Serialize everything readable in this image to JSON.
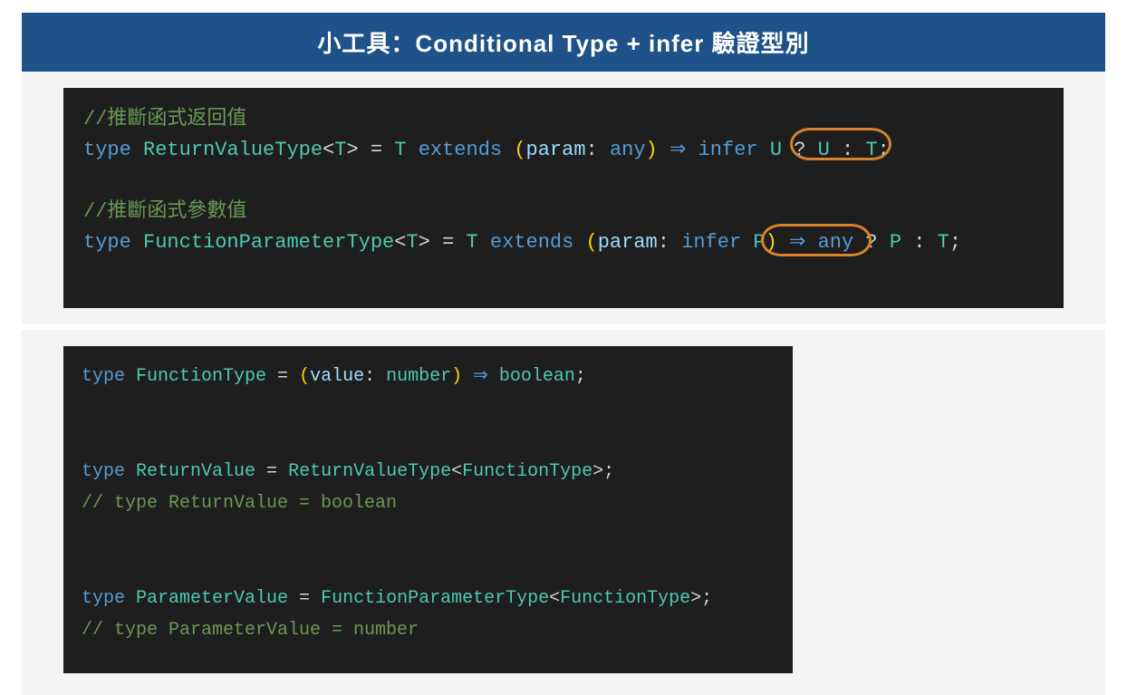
{
  "header": {
    "title": "小工具：Conditional Type + infer  驗證型別"
  },
  "code1": {
    "c1": "//推斷函式返回值",
    "l2": {
      "kw_type": "type ",
      "name": "ReturnValueType",
      "lt": "<",
      "T": "T",
      "gt": ">",
      "eq": " = ",
      "T2": "T ",
      "kw_extends": "extends ",
      "lp": "(",
      "param": "param",
      "colon": ": ",
      "any": "any",
      "rp": ") ",
      "arrow": "⇒ ",
      "infer": "infer ",
      "U": "U ",
      "qmark": "?",
      "sp": " ",
      "U2": "U ",
      "colon2": ": ",
      "T3": "T",
      "semi": ";"
    },
    "blank": "",
    "c2": "//推斷函式參數值",
    "l4": {
      "kw_type": "type ",
      "name": "FunctionParameterType",
      "lt": "<",
      "T": "T",
      "gt": ">",
      "eq": " = ",
      "T2": "T ",
      "kw_extends": "extends ",
      "lp": "(",
      "param": "param",
      "colon": ": ",
      "infer": "infer ",
      "P": "P",
      "rp": ")",
      "sp": " ",
      "arrow": "⇒ ",
      "any": "any ",
      "qmark": "?",
      "sp2": " ",
      "P2": "P ",
      "colon2": ": ",
      "T3": "T",
      "semi": ";"
    }
  },
  "code2": {
    "l1": {
      "kw_type": "type ",
      "name": "FunctionType",
      "eq": " = ",
      "lp": "(",
      "param": "value",
      "colon": ": ",
      "ptype": "number",
      "rp": ") ",
      "arrow": "⇒ ",
      "ret": "boolean",
      "semi": ";"
    },
    "blank1": "",
    "blank1b": "",
    "l2": {
      "kw_type": "type ",
      "name": "ReturnValue",
      "eq": " = ",
      "gen": "ReturnValueType",
      "lt": "<",
      "arg": "FunctionType",
      "gt": ">",
      "semi": ";"
    },
    "c1": "// type ReturnValue = boolean",
    "blank2": "",
    "blank2b": "",
    "l3": {
      "kw_type": "type ",
      "name": "ParameterValue",
      "eq": " = ",
      "gen": "FunctionParameterType",
      "lt": "<",
      "arg": "FunctionType",
      "gt": ">",
      "semi": ";"
    },
    "c2": "// type ParameterValue = number"
  }
}
